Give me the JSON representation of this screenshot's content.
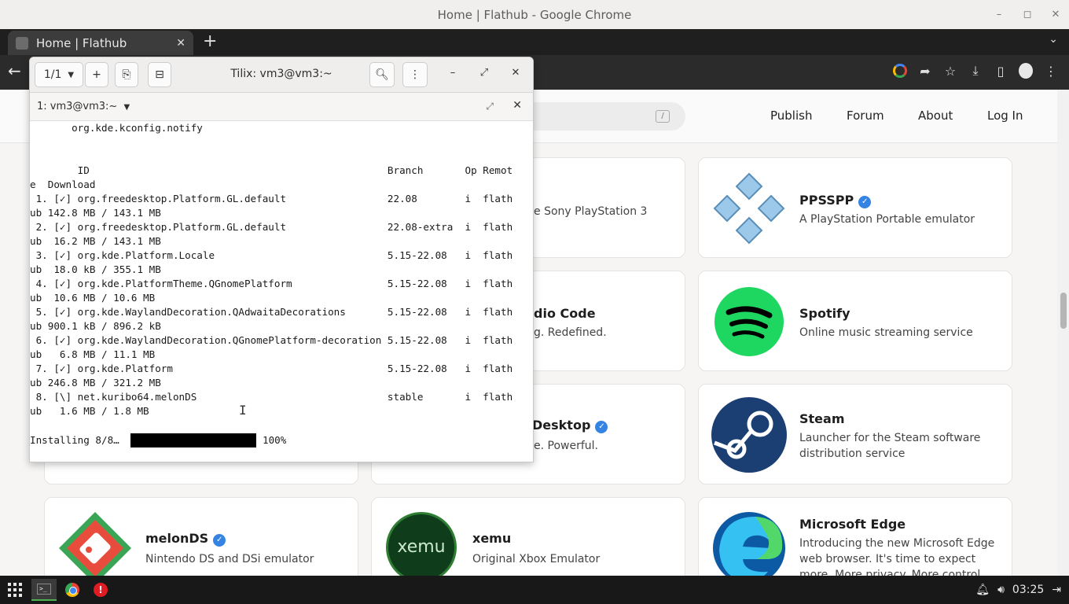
{
  "chrome": {
    "window_title": "Home | Flathub - Google Chrome",
    "min": "–",
    "max": "◻",
    "close": "✕",
    "tab_title": "Home | Flathub",
    "tab_close": "✕",
    "new_tab": "+",
    "tab_dropdown": "⌄",
    "back": "←"
  },
  "flathub": {
    "search_shortcut": "/",
    "nav": [
      "Publish",
      "Forum",
      "About",
      "Log In"
    ],
    "apps": {
      "partial_ps3_desc": "e Sony PlayStation 3",
      "partial_vscode_name": "dio Code",
      "partial_vscode_desc": "g. Redefined.",
      "partial_desktop_name": "Desktop",
      "partial_desktop_desc": "e. Powerful.",
      "ppsspp_name": "PPSSPP",
      "ppsspp_desc": "A PlayStation Portable emulator",
      "spotify_name": "Spotify",
      "spotify_desc": "Online music streaming service",
      "steam_name": "Steam",
      "steam_desc": "Launcher for the Steam software distribution service",
      "melonds_name": "melonDS",
      "melonds_desc": "Nintendo DS and DSi emulator",
      "xemu_name": "xemu",
      "xemu_logo": "xemu",
      "xemu_desc": "Original Xbox Emulator",
      "edge_name": "Microsoft Edge",
      "edge_desc": "Introducing the new Microsoft Edge web browser. It's time to expect more. More privacy. More control. More"
    }
  },
  "tilix": {
    "session_counter": "1/1",
    "title": "Tilix: vm3@vm3:~",
    "session_label": "1: vm3@vm3:~",
    "terminal_lines": [
      "       org.kde.kconfig.notify",
      "",
      "",
      "        ID                                                  Branch       Op Remot",
      "e  Download",
      " 1. [✓] org.freedesktop.Platform.GL.default                 22.08        i  flath",
      "ub 142.8 MB / 143.1 MB",
      " 2. [✓] org.freedesktop.Platform.GL.default                 22.08-extra  i  flath",
      "ub  16.2 MB / 143.1 MB",
      " 3. [✓] org.kde.Platform.Locale                             5.15-22.08   i  flath",
      "ub  18.0 kB / 355.1 MB",
      " 4. [✓] org.kde.PlatformTheme.QGnomePlatform                5.15-22.08   i  flath",
      "ub  10.6 MB / 10.6 MB",
      " 5. [✓] org.kde.WaylandDecoration.QAdwaitaDecorations       5.15-22.08   i  flath",
      "ub 900.1 kB / 896.2 kB",
      " 6. [✓] org.kde.WaylandDecoration.QGnomePlatform-decoration 5.15-22.08   i  flath",
      "ub   6.8 MB / 11.1 MB",
      " 7. [✓] org.kde.Platform                                    5.15-22.08   i  flath",
      "ub 246.8 MB / 321.2 MB",
      " 8. [\\] net.kuribo64.melonDS                                stable       i  flath",
      "ub   1.6 MB / 1.8 MB",
      ""
    ],
    "installing_label": "Installing 8/8…",
    "progress_percent_text": "100%",
    "progress_fraction": 1.0
  },
  "taskbar": {
    "clock": "03:25"
  }
}
